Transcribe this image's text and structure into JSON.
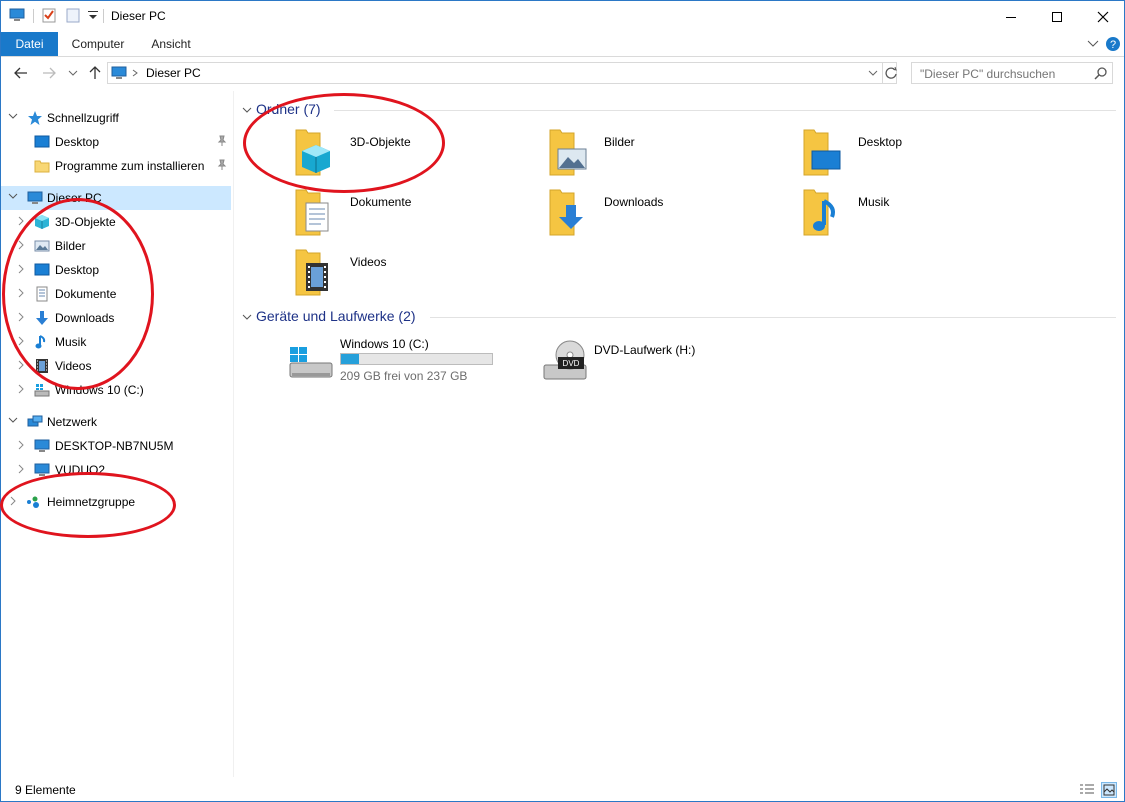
{
  "window": {
    "title": "Dieser PC"
  },
  "ribbon": {
    "tabs": [
      {
        "label": "Datei"
      },
      {
        "label": "Computer"
      },
      {
        "label": "Ansicht"
      }
    ]
  },
  "address": {
    "path": "Dieser PC"
  },
  "search": {
    "placeholder": "\"Dieser PC\" durchsuchen"
  },
  "nav": {
    "quick_access": "Schnellzugriff",
    "quick_items": [
      {
        "label": "Desktop"
      },
      {
        "label": "Programme zum installieren"
      }
    ],
    "this_pc": "Dieser PC",
    "pc_items": [
      {
        "label": "3D-Objekte"
      },
      {
        "label": "Bilder"
      },
      {
        "label": "Desktop"
      },
      {
        "label": "Dokumente"
      },
      {
        "label": "Downloads"
      },
      {
        "label": "Musik"
      },
      {
        "label": "Videos"
      },
      {
        "label": "Windows 10 (C:)"
      }
    ],
    "network": "Netzwerk",
    "network_items": [
      {
        "label": "DESKTOP-NB7NU5M"
      },
      {
        "label": "VUDUO2"
      }
    ],
    "homegroup": "Heimnetzgruppe"
  },
  "content": {
    "folders_header": "Ordner (7)",
    "folders": [
      {
        "label": "3D-Objekte"
      },
      {
        "label": "Bilder"
      },
      {
        "label": "Desktop"
      },
      {
        "label": "Dokumente"
      },
      {
        "label": "Downloads"
      },
      {
        "label": "Musik"
      },
      {
        "label": "Videos"
      }
    ],
    "drives_header": "Geräte und Laufwerke (2)",
    "drives": [
      {
        "label": "Windows 10 (C:)",
        "free_text": "209 GB frei von 237 GB",
        "used_fraction": 0.12
      },
      {
        "label": "DVD-Laufwerk (H:)"
      }
    ]
  },
  "status": {
    "items_text": "9 Elemente"
  },
  "colors": {
    "accent": "#1979ca",
    "selection": "#cce8ff",
    "group_header": "#1e3287",
    "annotation": "#e0141e",
    "folder": "#f5c542"
  }
}
